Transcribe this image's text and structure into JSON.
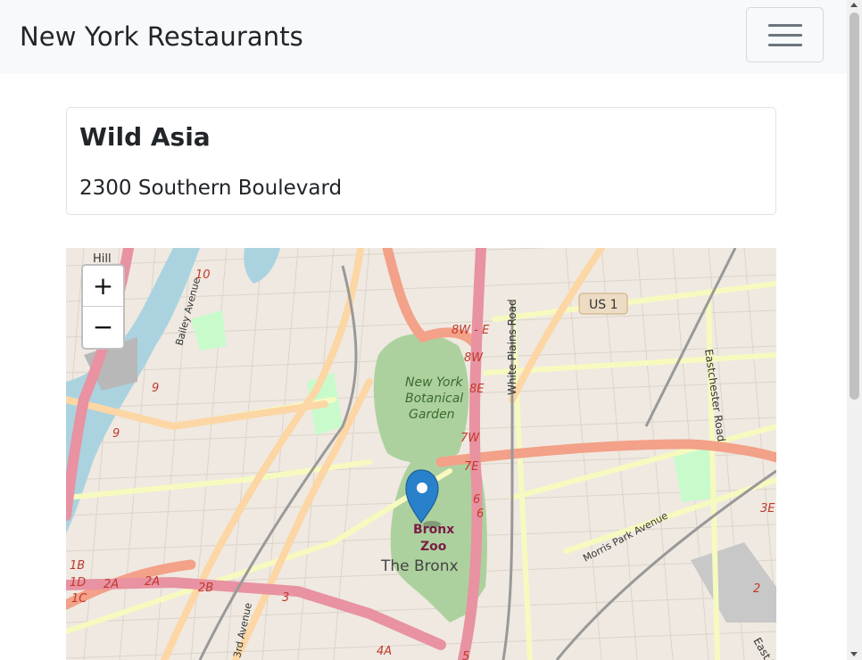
{
  "navbar": {
    "brand": "New York Restaurants"
  },
  "restaurant": {
    "name": "Wild Asia",
    "address": "2300 Southern Boulevard"
  },
  "map": {
    "zoom_in": "+",
    "zoom_out": "−",
    "labels": {
      "garden": [
        "New York",
        "Botanical",
        "Garden"
      ],
      "zoo": [
        "Bronx",
        "Zoo"
      ],
      "borough": "The Bronx",
      "us1": "US 1",
      "white_plains": "White Plains Road",
      "eastchester": "Eastchester Road",
      "morris_park": "Morris Park Avenue",
      "bailey": "Bailey Avenue",
      "third_ave": "3rd Avenue",
      "east_tr": "East Tr",
      "hill": "Hill",
      "exits": [
        "10",
        "9",
        "9",
        "8W - E",
        "8W",
        "8E",
        "7W",
        "7E",
        "6",
        "6",
        "2A",
        "2A",
        "2B",
        "3",
        "1B",
        "1D",
        "1C",
        "4A",
        "5",
        "3E",
        "2"
      ]
    }
  }
}
